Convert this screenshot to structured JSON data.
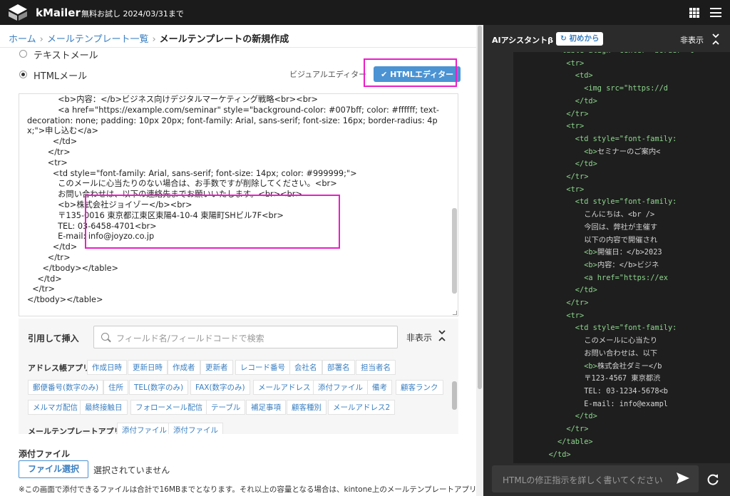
{
  "header": {
    "app_name": "kMailer",
    "trial_text": "無料お試し 2024/03/31まで"
  },
  "breadcrumb": {
    "home": "ホーム",
    "list": "メールテンプレート一覧",
    "current": "メールテンプレートの新規作成"
  },
  "format": {
    "text_label": "テキストメール",
    "html_label": "HTMLメール",
    "selected": "HTMLメール"
  },
  "editor_switch": {
    "visual_label": "ビジュアルエディター",
    "html_label": "✔ HTMLエディター"
  },
  "html_source": "            <b>内容：</b>ビジネス向けデジタルマーケティング戦略<br><br>\n            <a href=\"https://example.com/seminar\" style=\"background-color: #007bff; color: #ffffff; text-decoration: none; padding: 10px 20px; font-family: Arial, sans-serif; font-size: 16px; border-radius: 4px;\">申し込む</a>\n          </td>\n        </tr>\n        <tr>\n          <td style=\"font-family: Arial, sans-serif; font-size: 14px; color: #999999;\">\n            このメールに心当たりのない場合は、お手数ですが削除してください。<br>\n            お問い合わせは、以下の連絡先までお願いいたします。<br><br>\n            <b>株式会社ジョイゾー</b><br>\n            〒135-0016 東京都江東区東陽4-10-4 東陽町SHビル7F<br>\n            TEL: 03-6458-4701<br>\n            E-mail: info@joyzo.co.jp\n          </td>\n        </tr>\n      </tbody></table>\n    </td>\n  </tr>\n</tbody></table>",
  "insert": {
    "title": "引用して挿入",
    "search_placeholder": "フィールド名/フィールドコードで検索",
    "hide_label": "非表示",
    "address_app": "アドレス帳アプリ",
    "template_app": "メールテンプレートアプリ",
    "fields": [
      "作成日時",
      "更新日時",
      "作成者",
      "更新者",
      "レコード番号",
      "会社名",
      "部署名",
      "担当者名",
      "郵便番号(数字のみ)",
      "住所",
      "TEL(数字のみ)",
      "FAX(数字のみ)",
      "メールアドレス",
      "添付ファイル",
      "備考",
      "顧客ランク",
      "メルマガ配信",
      "最終接触日",
      "フォローメール配信",
      "テーブル",
      "補足事項",
      "顧客種別",
      "メールアドレス2"
    ],
    "template_fields": [
      "添付ファイル",
      "添付ファイル"
    ]
  },
  "attachment": {
    "title": "添付ファイル",
    "button": "ファイル選択",
    "none": "選択されていません",
    "note": "※この画面で添付できるファイルは合計で16MBまでとなります。それ以上の容量となる場合は、kintone上のメールテンプレートアプリ"
  },
  "assistant": {
    "title": "AIアシスタントβ",
    "restart_label": "初めから",
    "hide_label": "非表示",
    "input_placeholder": "HTMLの修正指示を詳しく書いてください",
    "code_lines": [
      [
        "          ",
        "<table align=\"center\" border=\"0\"",
        ""
      ],
      [
        "            ",
        "<tr>",
        ""
      ],
      [
        "              ",
        "<td>",
        ""
      ],
      [
        "                ",
        "<img src=\"https://d",
        ""
      ],
      [
        "              ",
        "</td>",
        ""
      ],
      [
        "            ",
        "</tr>",
        ""
      ],
      [
        "            ",
        "<tr>",
        ""
      ],
      [
        "              ",
        "<td style=\"font-family:",
        ""
      ],
      [
        "                ",
        "<b>",
        "セミナーのご案内<"
      ],
      [
        "              ",
        "</td>",
        ""
      ],
      [
        "            ",
        "</tr>",
        ""
      ],
      [
        "            ",
        "<tr>",
        ""
      ],
      [
        "              ",
        "<td style=\"font-family:",
        ""
      ],
      [
        "                ",
        "",
        "こんにちは、<br />"
      ],
      [
        "                ",
        "",
        "今回は、弊社が主催す"
      ],
      [
        "                ",
        "",
        "以下の内容で開催され"
      ],
      [
        "                ",
        "<b>",
        "開催日：</b>2023"
      ],
      [
        "                ",
        "<b>",
        "内容：</b>ビジネ"
      ],
      [
        "                ",
        "<a href=\"https://ex",
        ""
      ],
      [
        "              ",
        "</td>",
        ""
      ],
      [
        "            ",
        "</tr>",
        ""
      ],
      [
        "            ",
        "<tr>",
        ""
      ],
      [
        "              ",
        "<td style=\"font-family:",
        ""
      ],
      [
        "                ",
        "",
        "このメールに心当たり"
      ],
      [
        "                ",
        "",
        "お問い合わせは、以下"
      ],
      [
        "                ",
        "<b>",
        "株式会社ダミー</b"
      ],
      [
        "                ",
        "",
        "〒123-4567 東京都渋"
      ],
      [
        "                ",
        "",
        "TEL: 03-1234-5678<b"
      ],
      [
        "                ",
        "",
        "E-mail: info@exampl"
      ],
      [
        "              ",
        "</td>",
        ""
      ],
      [
        "            ",
        "</tr>",
        ""
      ],
      [
        "          ",
        "</table>",
        ""
      ],
      [
        "        ",
        "</td>",
        ""
      ],
      [
        "      ",
        "</tr>",
        ""
      ]
    ]
  },
  "colors": {
    "accent": "#4b93d3",
    "highlight": "#ea1ec8",
    "topbar": "#1b1b1b",
    "assistant_bg": "#2b2b2b"
  }
}
